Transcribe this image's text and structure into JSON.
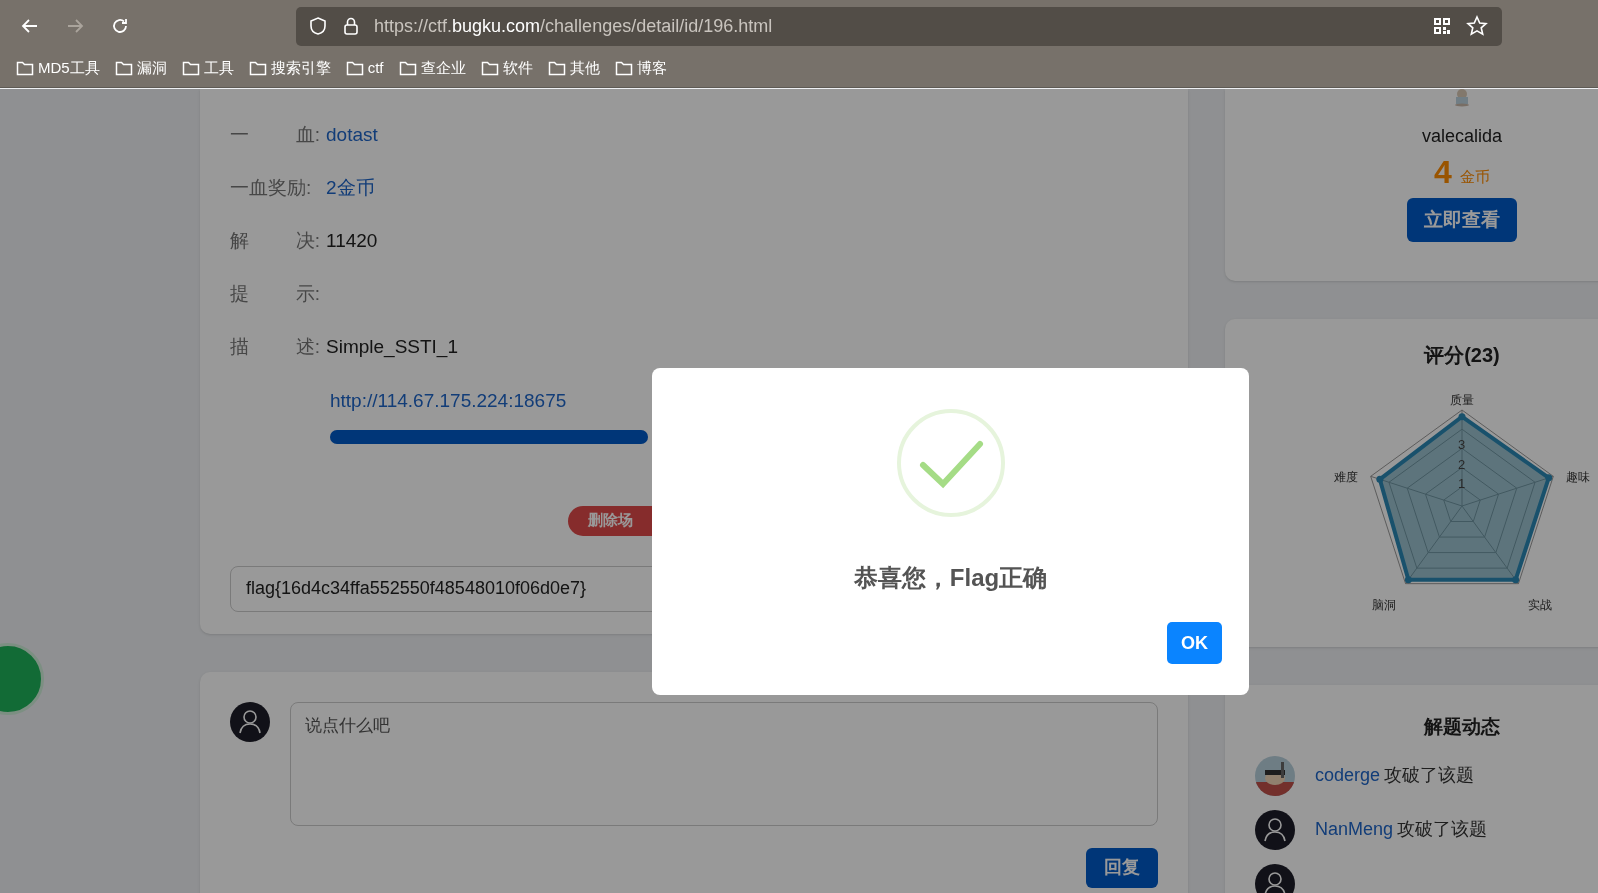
{
  "browser": {
    "address": {
      "prefix": "https://ctf.",
      "domain": "bugku.com",
      "path": "/challenges/detail/id/196.html"
    },
    "bookmarks": [
      "MD5工具",
      "漏洞",
      "工具",
      "搜索引擎",
      "ctf",
      "查企业",
      "软件",
      "其他",
      "博客"
    ]
  },
  "challenge": {
    "fields": [
      {
        "label": [
          "一",
          "血:"
        ],
        "value": "dotast",
        "kind": "link"
      },
      {
        "label": [
          "一血奖励:"
        ],
        "value": "2金币",
        "kind": "link"
      },
      {
        "label": [
          "解",
          "决:"
        ],
        "value": "11420",
        "kind": "text"
      },
      {
        "label": [
          "提",
          "示:"
        ]
      },
      {
        "label": [
          "描",
          "述:"
        ],
        "value": "Simple_SSTI_1",
        "kind": "text"
      }
    ],
    "url": "http://114.67.175.224:18675",
    "bar": {
      "level": 1
    },
    "delete_button": "删除场",
    "flag_input": "flag{16d4c34ffa552550f48548010f06d0e7}"
  },
  "comment": {
    "placeholder": "说点什么吧",
    "reply_button": "回复"
  },
  "author": {
    "name": "valecalida",
    "coins": "4",
    "coins_unit": "金币",
    "view_button": "立即查看"
  },
  "rating": {
    "title": "评分(23)",
    "axes": [
      "质量",
      "趣味",
      "实战",
      "脑洞",
      "难度"
    ],
    "ticks": [
      "3",
      "2",
      "1"
    ]
  },
  "solves": {
    "title": "解题动态",
    "items": [
      {
        "kind": "picture",
        "user": "coderge",
        "action": "攻破了该题"
      },
      {
        "kind": "default",
        "user": "NanMeng",
        "action": "攻破了该题"
      },
      {
        "kind": "default"
      }
    ]
  },
  "modal": {
    "message": "恭喜您，Flag正确",
    "button": "OK"
  }
}
